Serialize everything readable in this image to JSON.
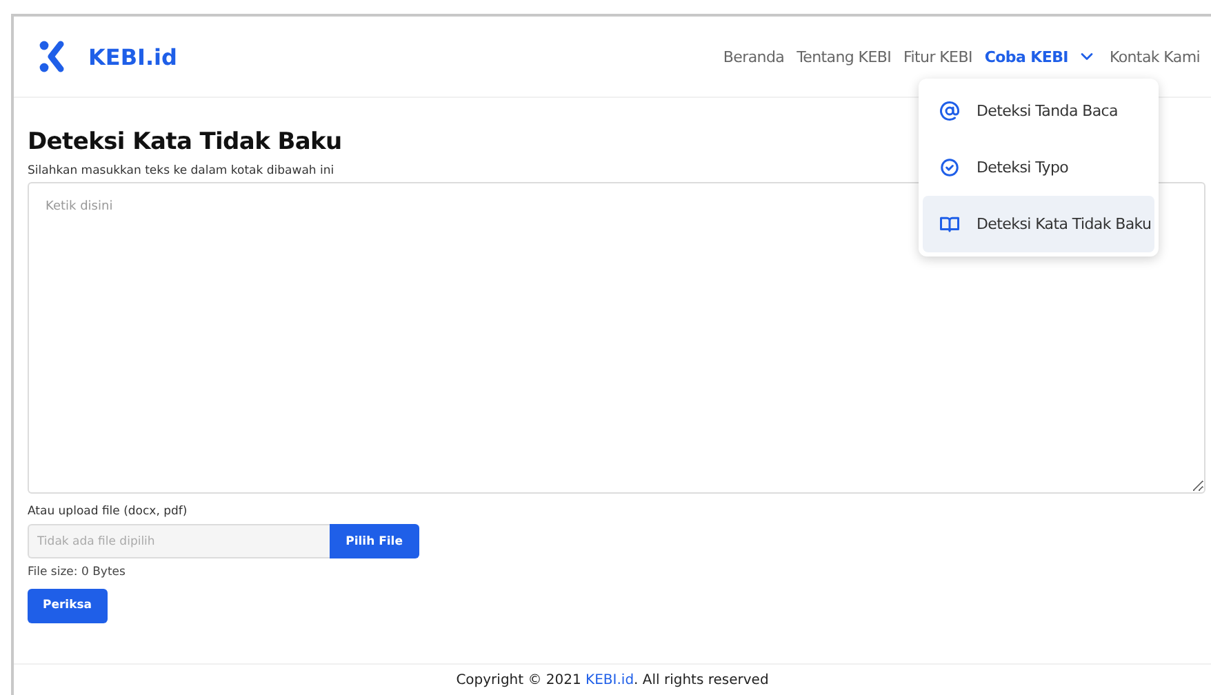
{
  "brand": {
    "name": "KEBI.id"
  },
  "nav": [
    {
      "label": "Beranda",
      "selected": false,
      "dropdown": false
    },
    {
      "label": "Tentang KEBI",
      "selected": false,
      "dropdown": false
    },
    {
      "label": "Fitur KEBI",
      "selected": false,
      "dropdown": false
    },
    {
      "label": "Coba KEBI",
      "selected": true,
      "dropdown": true
    },
    {
      "label": "Kontak Kami",
      "selected": false,
      "dropdown": false
    }
  ],
  "menu": [
    {
      "label": "Deteksi Tanda Baca",
      "kind": "at",
      "selected": false
    },
    {
      "label": "Deteksi Typo",
      "kind": "check",
      "selected": false
    },
    {
      "label": "Deteksi Kata Tidak Baku",
      "kind": "book",
      "selected": true
    }
  ],
  "title": "Deteksi Kata Tidak Baku",
  "subtitle": "Silahkan masukkan teks ke dalam kotak dibawah ini",
  "textarea": {
    "placeholder": "Ketik disini"
  },
  "upload": {
    "label": "Atau upload file (docx, pdf)",
    "placeholder": "Tidak ada file dipilih",
    "button": "Pilih File",
    "size": "File size: 0 Bytes"
  },
  "submit": "Periksa",
  "footer": {
    "prefix": "Copyright © 2021 ",
    "link": "KEBI.id",
    "suffix": ". All rights reserved"
  }
}
